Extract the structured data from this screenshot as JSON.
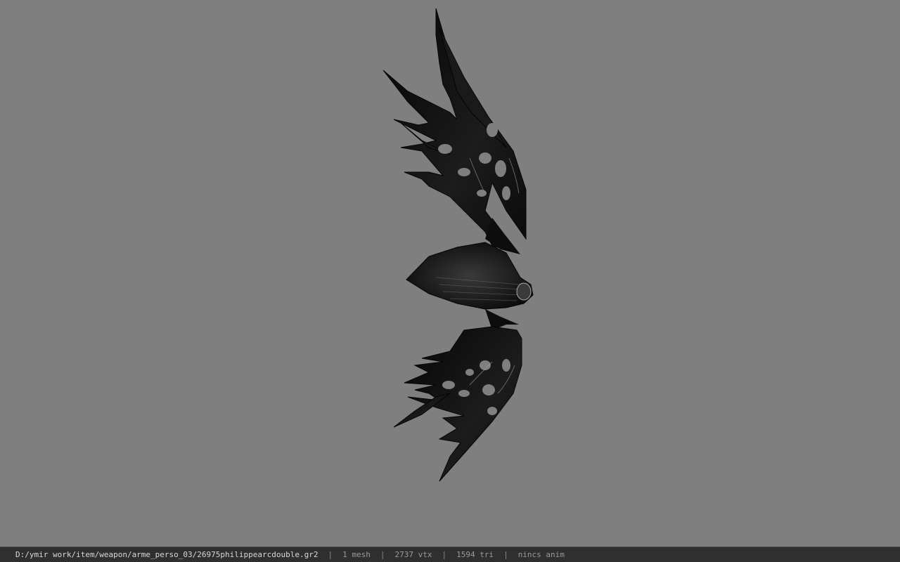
{
  "viewport": {
    "background_color": "#7f7f7f",
    "model_color": "#0e0e0e",
    "model_highlight": "#4a4a4a"
  },
  "statusbar": {
    "file_path": "D:/ymir work/item/weapon/arme_perso_03/26975philippearcdouble.gr2",
    "separator": "|",
    "mesh_count": "1 mesh",
    "vertex_count": "2737 vtx",
    "triangle_count": "1594 tri",
    "anim_status": "nincs anim"
  }
}
